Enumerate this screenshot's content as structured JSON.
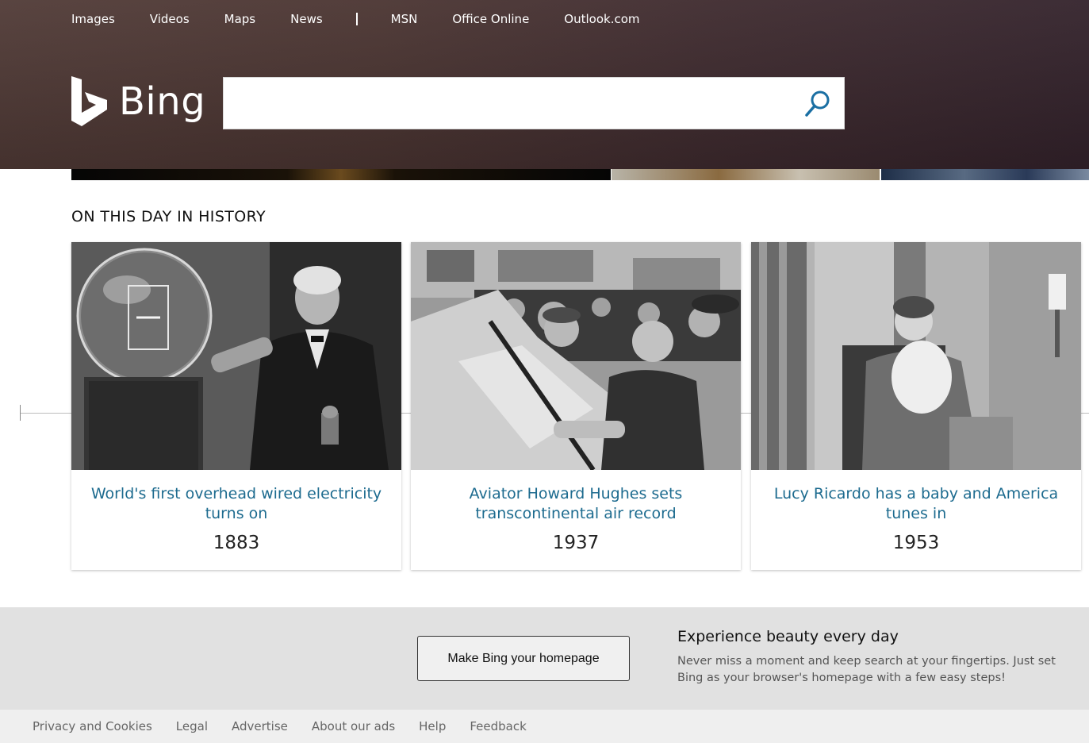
{
  "header": {
    "nav": [
      {
        "label": "Images"
      },
      {
        "label": "Videos"
      },
      {
        "label": "Maps"
      },
      {
        "label": "News"
      },
      {
        "label": "MSN"
      },
      {
        "label": "Office Online"
      },
      {
        "label": "Outlook.com"
      }
    ],
    "logo_text": "Bing",
    "search": {
      "value": "",
      "placeholder": ""
    }
  },
  "history": {
    "title": "ON THIS DAY IN HISTORY",
    "cards": [
      {
        "title": "World's first overhead wired electricity turns on",
        "year": "1883"
      },
      {
        "title": "Aviator Howard Hughes sets transcontinental air record",
        "year": "1937"
      },
      {
        "title": "Lucy Ricardo has a baby and America tunes in",
        "year": "1953"
      }
    ]
  },
  "promo": {
    "button_label": "Make Bing your homepage",
    "title": "Experience beauty every day",
    "description": "Never miss a moment and keep search at your fingertips. Just set Bing as your browser's homepage with a few easy steps!"
  },
  "footer": {
    "links": [
      {
        "label": "Privacy and Cookies"
      },
      {
        "label": "Legal"
      },
      {
        "label": "Advertise"
      },
      {
        "label": "About our ads"
      },
      {
        "label": "Help"
      },
      {
        "label": "Feedback"
      }
    ]
  },
  "colors": {
    "link_blue": "#1d6b8f",
    "search_icon": "#1a6fa3",
    "header_bg": "#4a3431"
  }
}
